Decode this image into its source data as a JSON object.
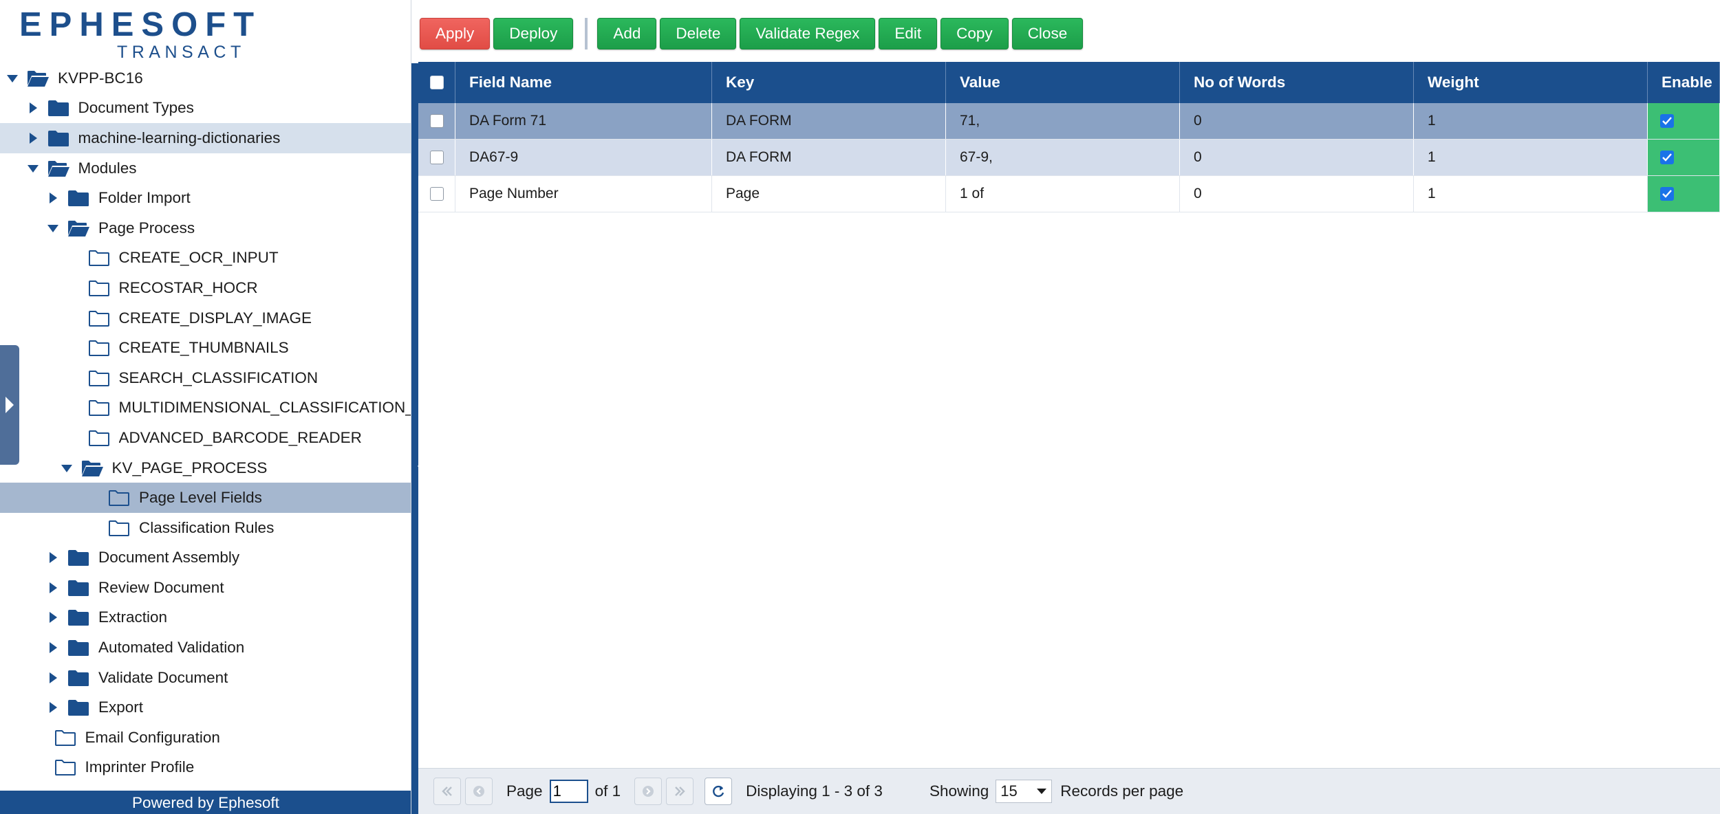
{
  "logo": {
    "word": "EPHESOFT",
    "sub": "TRANSACT"
  },
  "tree": [
    {
      "label": "KVPP-BC16",
      "level": 0,
      "arrow": "down",
      "folder": "open"
    },
    {
      "label": "Document Types",
      "level": 1,
      "arrow": "right",
      "folder": "closed"
    },
    {
      "label": "machine-learning-dictionaries",
      "level": 1,
      "arrow": "right",
      "folder": "closed",
      "state": "selected"
    },
    {
      "label": "Modules",
      "level": 1,
      "arrow": "down",
      "folder": "open"
    },
    {
      "label": "Folder Import",
      "level": 2,
      "arrow": "right",
      "folder": "closed"
    },
    {
      "label": "Page Process",
      "level": 2,
      "arrow": "down",
      "folder": "open"
    },
    {
      "label": "CREATE_OCR_INPUT",
      "level": 3,
      "arrow": "none",
      "folder": "outline"
    },
    {
      "label": "RECOSTAR_HOCR",
      "level": 3,
      "arrow": "none",
      "folder": "outline"
    },
    {
      "label": "CREATE_DISPLAY_IMAGE",
      "level": 3,
      "arrow": "none",
      "folder": "outline"
    },
    {
      "label": "CREATE_THUMBNAILS",
      "level": 3,
      "arrow": "none",
      "folder": "outline"
    },
    {
      "label": "SEARCH_CLASSIFICATION",
      "level": 3,
      "arrow": "none",
      "folder": "outline"
    },
    {
      "label": "MULTIDIMENSIONAL_CLASSIFICATION_P",
      "level": 3,
      "arrow": "none",
      "folder": "outline"
    },
    {
      "label": "ADVANCED_BARCODE_READER",
      "level": 3,
      "arrow": "none",
      "folder": "outline"
    },
    {
      "label": "KV_PAGE_PROCESS",
      "level": 3,
      "arrow": "down",
      "folder": "open",
      "shift": -1
    },
    {
      "label": "Page Level Fields",
      "level": 4,
      "arrow": "none",
      "folder": "outline",
      "state": "selected-strong"
    },
    {
      "label": "Classification Rules",
      "level": 4,
      "arrow": "none",
      "folder": "outline"
    },
    {
      "label": "Document Assembly",
      "level": 2,
      "arrow": "right",
      "folder": "closed"
    },
    {
      "label": "Review Document",
      "level": 2,
      "arrow": "right",
      "folder": "closed"
    },
    {
      "label": "Extraction",
      "level": 2,
      "arrow": "right",
      "folder": "closed"
    },
    {
      "label": "Automated Validation",
      "level": 2,
      "arrow": "right",
      "folder": "closed"
    },
    {
      "label": "Validate Document",
      "level": 2,
      "arrow": "right",
      "folder": "closed"
    },
    {
      "label": "Export",
      "level": 2,
      "arrow": "right",
      "folder": "closed"
    },
    {
      "label": "Email Configuration",
      "level": 1,
      "arrow": "none",
      "folder": "outline",
      "shift": 1
    },
    {
      "label": "Imprinter Profile",
      "level": 1,
      "arrow": "none",
      "folder": "outline",
      "shift": 1
    }
  ],
  "footer": "Powered by Ephesoft",
  "toolbar": {
    "apply": "Apply",
    "deploy": "Deploy",
    "add": "Add",
    "delete": "Delete",
    "validate_regex": "Validate Regex",
    "edit": "Edit",
    "copy": "Copy",
    "close": "Close"
  },
  "grid": {
    "headers": {
      "field_name": "Field Name",
      "key": "Key",
      "value": "Value",
      "words": "No of Words",
      "weight": "Weight",
      "enable": "Enable"
    },
    "rows": [
      {
        "field_name": "DA Form 71",
        "key": "DA FORM",
        "value": "71,",
        "words": "0",
        "weight": "1",
        "enabled": true,
        "state": "sel"
      },
      {
        "field_name": "DA67-9",
        "key": "DA FORM",
        "value": "67-9,",
        "words": "0",
        "weight": "1",
        "enabled": true,
        "state": "alt"
      },
      {
        "field_name": "Page Number",
        "key": "Page",
        "value": "1 of",
        "words": "0",
        "weight": "1",
        "enabled": true,
        "state": "plain"
      }
    ]
  },
  "pager": {
    "page_label": "Page",
    "page_value": "1",
    "of_label": "of 1",
    "displaying": "Displaying 1 - 3 of 3",
    "showing_label": "Showing",
    "per_page": "15",
    "records_label": "Records per page"
  },
  "colors": {
    "navy": "#1b4f8d",
    "green": "#22a954",
    "red": "#e8574f",
    "enable_green": "#3cbf74"
  }
}
